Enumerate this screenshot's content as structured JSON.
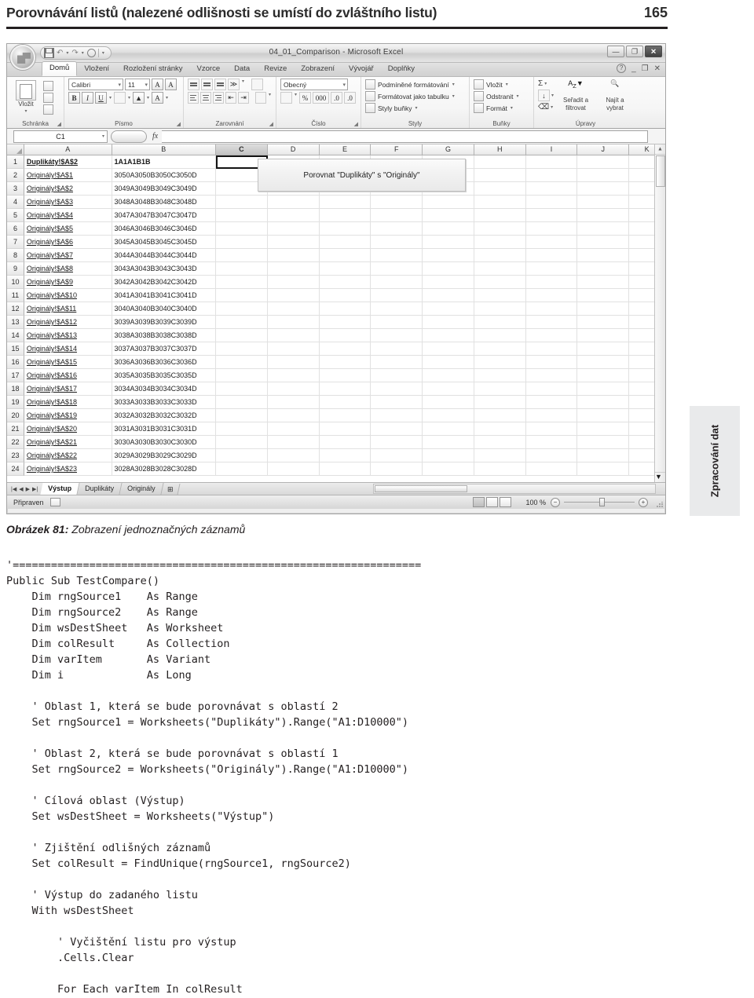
{
  "running_head": {
    "title": "Porovnávání listů (nalezené odlišnosti se umístí do zvláštního listu)",
    "page_number": "165"
  },
  "side_tab": {
    "label": "Zpracování dat"
  },
  "excel": {
    "title_bar": {
      "document_title": "04_01_Comparison - Microsoft Excel",
      "quick_access": [
        "save-icon",
        "undo-icon",
        "redo-icon",
        "print-preview-icon",
        "customize-qat-icon"
      ],
      "window_buttons": {
        "minimize": "—",
        "restore": "❐",
        "close": "✕"
      }
    },
    "ribbon_tabs": [
      {
        "label": "Domů",
        "active": true
      },
      {
        "label": "Vložení",
        "active": false
      },
      {
        "label": "Rozložení stránky",
        "active": false
      },
      {
        "label": "Vzorce",
        "active": false
      },
      {
        "label": "Data",
        "active": false
      },
      {
        "label": "Revize",
        "active": false
      },
      {
        "label": "Zobrazení",
        "active": false
      },
      {
        "label": "Vývojář",
        "active": false
      },
      {
        "label": "Doplňky",
        "active": false
      }
    ],
    "ribbon_groups": {
      "clipboard": {
        "label": "Schránka",
        "paste_label": "Vložit"
      },
      "font": {
        "label": "Písmo",
        "font_name": "Calibri",
        "font_size": "11",
        "grow_label": "A",
        "shrink_label": "A",
        "bold_label": "B",
        "italic_label": "I",
        "underline_label": "U"
      },
      "alignment": {
        "label": "Zarovnání"
      },
      "number": {
        "label": "Číslo",
        "format": "Obecný",
        "percent_label": "%",
        "thousands_label": "000"
      },
      "styles": {
        "label": "Styly",
        "items": [
          "Podmíněné formátování",
          "Formátovat jako tabulku",
          "Styly buňky"
        ]
      },
      "cells": {
        "label": "Buňky",
        "items": [
          "Vložit",
          "Odstranit",
          "Formát"
        ]
      },
      "editing": {
        "label": "Úpravy",
        "sort_filter": "Seřadit a filtrovat",
        "find_select": "Najít a vybrat",
        "autosum": "Σ"
      }
    },
    "formula_bar": {
      "name_box": "C1",
      "formula_value": "",
      "fx_label": "fx"
    },
    "grid": {
      "columns": [
        "A",
        "B",
        "C",
        "D",
        "E",
        "F",
        "G",
        "H",
        "I",
        "J",
        "K"
      ],
      "selected_column": "C",
      "selected_cell": "C1",
      "rows": [
        {
          "num": "1",
          "a": "Duplikáty!$A$2",
          "b": "1A1A1B1B"
        },
        {
          "num": "2",
          "a": "Originály!$A$1",
          "b": "3050A3050B3050C3050D"
        },
        {
          "num": "3",
          "a": "Originály!$A$2",
          "b": "3049A3049B3049C3049D"
        },
        {
          "num": "4",
          "a": "Originály!$A$3",
          "b": "3048A3048B3048C3048D"
        },
        {
          "num": "5",
          "a": "Originály!$A$4",
          "b": "3047A3047B3047C3047D"
        },
        {
          "num": "6",
          "a": "Originály!$A$5",
          "b": "3046A3046B3046C3046D"
        },
        {
          "num": "7",
          "a": "Originály!$A$6",
          "b": "3045A3045B3045C3045D"
        },
        {
          "num": "8",
          "a": "Originály!$A$7",
          "b": "3044A3044B3044C3044D"
        },
        {
          "num": "9",
          "a": "Originály!$A$8",
          "b": "3043A3043B3043C3043D"
        },
        {
          "num": "10",
          "a": "Originály!$A$9",
          "b": "3042A3042B3042C3042D"
        },
        {
          "num": "11",
          "a": "Originály!$A$10",
          "b": "3041A3041B3041C3041D"
        },
        {
          "num": "12",
          "a": "Originály!$A$11",
          "b": "3040A3040B3040C3040D"
        },
        {
          "num": "13",
          "a": "Originály!$A$12",
          "b": "3039A3039B3039C3039D"
        },
        {
          "num": "14",
          "a": "Originály!$A$13",
          "b": "3038A3038B3038C3038D"
        },
        {
          "num": "15",
          "a": "Originály!$A$14",
          "b": "3037A3037B3037C3037D"
        },
        {
          "num": "16",
          "a": "Originály!$A$15",
          "b": "3036A3036B3036C3036D"
        },
        {
          "num": "17",
          "a": "Originály!$A$16",
          "b": "3035A3035B3035C3035D"
        },
        {
          "num": "18",
          "a": "Originály!$A$17",
          "b": "3034A3034B3034C3034D"
        },
        {
          "num": "19",
          "a": "Originály!$A$18",
          "b": "3033A3033B3033C3033D"
        },
        {
          "num": "20",
          "a": "Originály!$A$19",
          "b": "3032A3032B3032C3032D"
        },
        {
          "num": "21",
          "a": "Originály!$A$20",
          "b": "3031A3031B3031C3031D"
        },
        {
          "num": "22",
          "a": "Originály!$A$21",
          "b": "3030A3030B3030C3030D"
        },
        {
          "num": "23",
          "a": "Originály!$A$22",
          "b": "3029A3029B3029C3029D"
        },
        {
          "num": "24",
          "a": "Originály!$A$23",
          "b": "3028A3028B3028C3028D"
        }
      ],
      "callout_button": "Porovnat \"Duplikáty\" s \"Originály\""
    },
    "sheet_tabs": [
      {
        "label": "Výstup",
        "active": true
      },
      {
        "label": "Duplikáty",
        "active": false
      },
      {
        "label": "Originály",
        "active": false
      }
    ],
    "status_bar": {
      "status": "Připraven",
      "zoom_level": "100 %",
      "zoom_out": "−",
      "zoom_in": "+"
    }
  },
  "caption": {
    "label": "Obrázek 81:",
    "text": " Zobrazení jednoznačných záznamů"
  },
  "code": {
    "lines": [
      "'================================================================",
      "Public Sub TestCompare()",
      "    Dim rngSource1    As Range",
      "    Dim rngSource2    As Range",
      "    Dim wsDestSheet   As Worksheet",
      "    Dim colResult     As Collection",
      "    Dim varItem       As Variant",
      "    Dim i             As Long",
      "",
      "    ' Oblast 1, která se bude porovnávat s oblastí 2",
      "    Set rngSource1 = Worksheets(\"Duplikáty\").Range(\"A1:D10000\")",
      "",
      "    ' Oblast 2, která se bude porovnávat s oblastí 1",
      "    Set rngSource2 = Worksheets(\"Originály\").Range(\"A1:D10000\")",
      "",
      "    ' Cílová oblast (Výstup)",
      "    Set wsDestSheet = Worksheets(\"Výstup\")",
      "",
      "    ' Zjištění odlišných záznamů",
      "    Set colResult = FindUnique(rngSource1, rngSource2)",
      "",
      "    ' Výstup do zadaného listu",
      "    With wsDestSheet",
      "",
      "        ' Vyčištění listu pro výstup",
      "        .Cells.Clear",
      "",
      "        For Each varItem In colResult"
    ]
  }
}
